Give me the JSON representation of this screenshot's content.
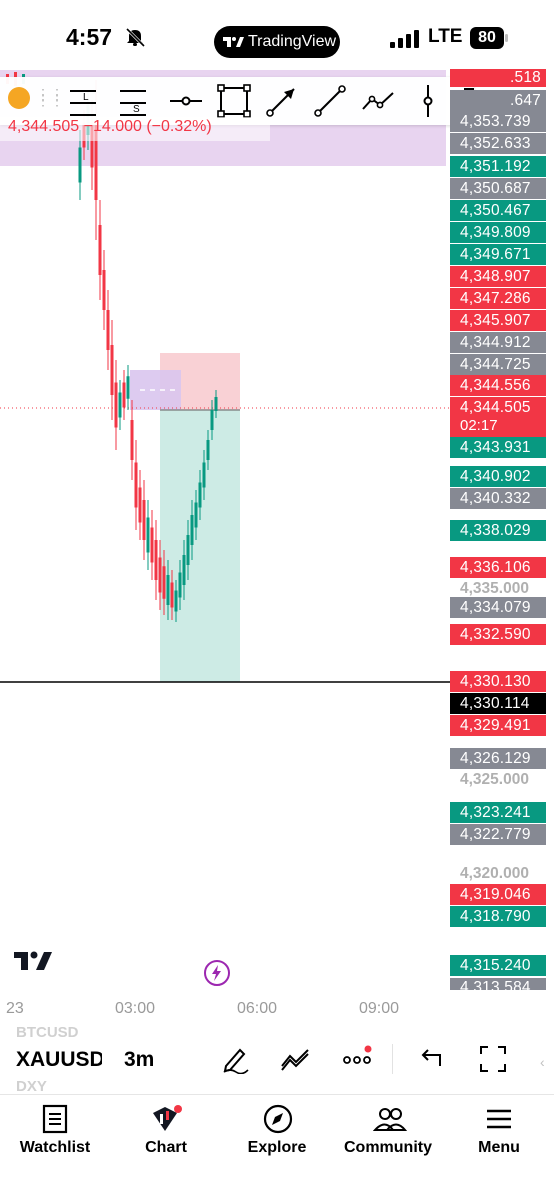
{
  "status_bar": {
    "time": "4:57",
    "network": "LTE",
    "battery": "80",
    "app_pill": "TradingView",
    "bell_icon": "bell-slash-icon"
  },
  "toolbar": {
    "icons": [
      "ruler-l-icon",
      "ruler-s-icon",
      "horizontal-line-icon",
      "rectangle-icon",
      "arrow-icon",
      "trend-line-icon",
      "path-icon",
      "vertical-line-icon",
      "text-icon"
    ]
  },
  "change_text": "4,344.505 −14.000 (−0.32%)",
  "price_labels": [
    {
      "text": "4,353.739",
      "color": "#868993"
    },
    {
      "text": "4,352.633",
      "color": "#868993"
    },
    {
      "text": "4,351.192",
      "color": "#089981"
    },
    {
      "text": "4,350.687",
      "color": "#868993"
    },
    {
      "text": "4,350.467",
      "color": "#089981"
    },
    {
      "text": "4,349.809",
      "color": "#089981"
    },
    {
      "text": "4,349.671",
      "color": "#089981"
    },
    {
      "text": "4,348.907",
      "color": "#f23645"
    },
    {
      "text": "4,347.286",
      "color": "#f23645"
    },
    {
      "text": "4,345.907",
      "color": "#f23645"
    },
    {
      "text": "4,344.912",
      "color": "#868993"
    },
    {
      "text": "4,344.725",
      "color": "#868993"
    },
    {
      "text": "4,344.556",
      "color": "#f23645"
    },
    {
      "text": "4,344.505",
      "color": "#f23645"
    },
    {
      "text": "4,343.931",
      "color": "#089981"
    },
    {
      "text": "4,340.902",
      "color": "#089981"
    },
    {
      "text": "4,340.332",
      "color": "#868993"
    },
    {
      "text": "4,338.029",
      "color": "#089981"
    },
    {
      "text": "4,336.106",
      "color": "#f23645"
    },
    {
      "text": "4,334.079",
      "color": "#868993"
    },
    {
      "text": "4,332.590",
      "color": "#f23645"
    },
    {
      "text": "4,330.130",
      "color": "#f23645"
    },
    {
      "text": "4,330.114",
      "color": "#000000"
    },
    {
      "text": "4,329.491",
      "color": "#f23645"
    },
    {
      "text": "4,326.129",
      "color": "#868993"
    },
    {
      "text": "4,323.241",
      "color": "#089981"
    },
    {
      "text": "4,322.779",
      "color": "#868993"
    },
    {
      "text": "4,319.046",
      "color": "#f23645"
    },
    {
      "text": "4,318.790",
      "color": "#089981"
    },
    {
      "text": "4,315.240",
      "color": "#089981"
    }
  ],
  "partial_labels": {
    "top_red": ".518",
    "top_grey": ".647",
    "bottom_grey": "4,313.584"
  },
  "countdown": "02:17",
  "grid_ticks": [
    "4,335.000",
    "4,325.000",
    "4,320.000"
  ],
  "time_labels": [
    "23",
    "03:00",
    "06:00",
    "09:00"
  ],
  "symbols": {
    "above": "BTCUSD",
    "current": "XAUUSD",
    "below": "DXY",
    "interval": "3m"
  },
  "tabs": [
    {
      "label": "Watchlist",
      "icon": "watchlist-icon"
    },
    {
      "label": "Chart",
      "icon": "chart-icon"
    },
    {
      "label": "Explore",
      "icon": "compass-icon"
    },
    {
      "label": "Community",
      "icon": "community-icon"
    },
    {
      "label": "Menu",
      "icon": "menu-icon"
    }
  ]
}
